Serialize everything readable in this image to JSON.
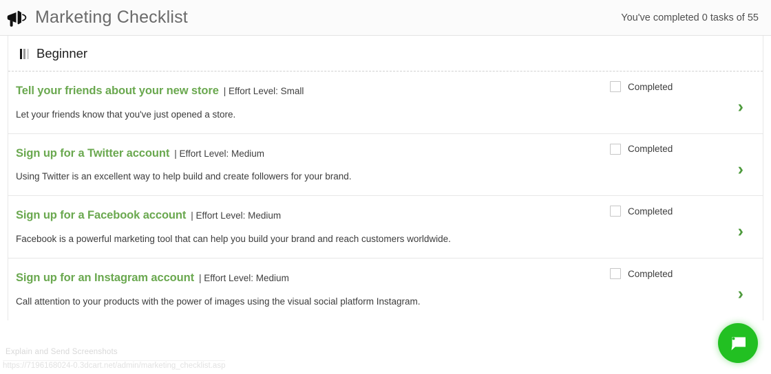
{
  "header": {
    "icon": "megaphone-icon",
    "title": "Marketing Checklist",
    "progress_text": "You've completed 0 tasks of 55"
  },
  "section": {
    "icon": "signal-bars-icon",
    "title": "Beginner",
    "level_bar_colors": [
      "#1c1c1c",
      "#9a9a9a",
      "#d6d6d6"
    ]
  },
  "colors": {
    "task_title_green": "#6aa84f",
    "chevron_green": "#4d9a3c",
    "chat_green": "#22c022"
  },
  "tasks": [
    {
      "title": "Tell your friends about your new store",
      "effort": "| Effort Level: Small",
      "description": "Let your friends know that you've just opened a store.",
      "completed_label": "Completed",
      "checked": false,
      "chevron": "›"
    },
    {
      "title": "Sign up for a Twitter account",
      "effort": "| Effort Level: Medium",
      "description": "Using Twitter is an excellent way to help build and create followers for your brand.",
      "completed_label": "Completed",
      "checked": false,
      "chevron": "›"
    },
    {
      "title": "Sign up for a Facebook account",
      "effort": "| Effort Level: Medium",
      "description": "Facebook is a powerful marketing tool that can help you build your brand and reach customers worldwide.",
      "completed_label": "Completed",
      "checked": false,
      "chevron": "›"
    },
    {
      "title": "Sign up for an Instagram account",
      "effort": "| Effort Level: Medium",
      "description": "Call attention to your products with the power of images using the visual social platform Instagram.",
      "completed_label": "Completed",
      "checked": false,
      "chevron": "›"
    }
  ],
  "overlays": {
    "screenshot_hint": "Explain and Send Screenshots",
    "status_url": "https://7196168024-0.3dcart.net/admin/marketing_checklist.asp"
  },
  "chat_widget": {
    "icon": "chat-bubble-icon"
  }
}
